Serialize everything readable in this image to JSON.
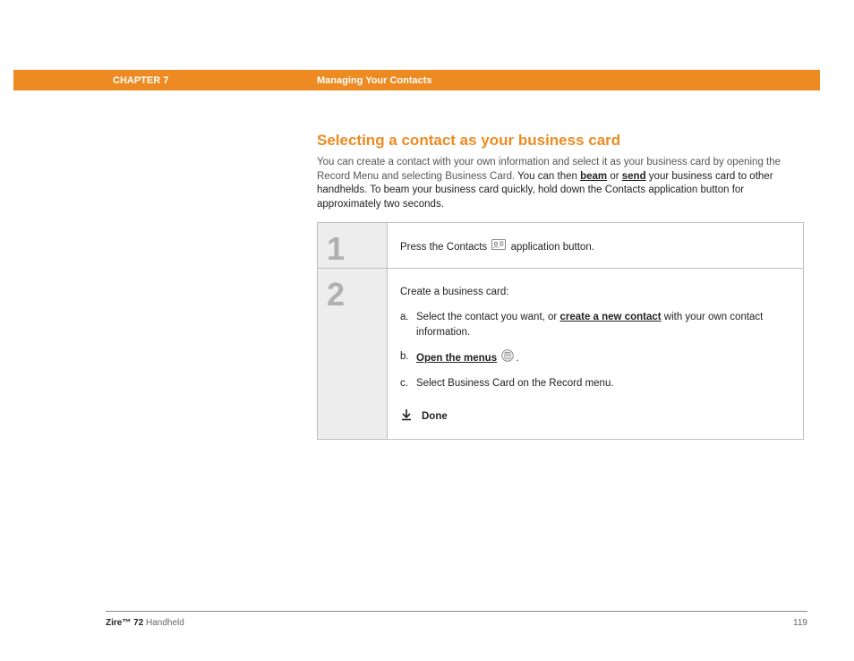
{
  "header": {
    "chapter": "CHAPTER 7",
    "title": "Managing Your Contacts"
  },
  "section": {
    "heading": "Selecting a contact as your business card",
    "intro_gray_part": "You can create a contact with your own information and select it as your business card by opening the Record Menu and selecting Business Card.",
    "intro_dark_prefix": " You can then ",
    "link_beam": "beam",
    "intro_dark_mid": " or ",
    "link_send": "send",
    "intro_dark_suffix": " your business card to other handhelds. To beam your business card quickly, hold down the Contacts application button for approximately two seconds."
  },
  "steps": [
    {
      "num": "1",
      "prefix": "Press the Contacts ",
      "suffix": " application button."
    },
    {
      "num": "2",
      "lead": "Create a business card:",
      "a_prefix": "Select the contact you want, or ",
      "a_link": "create a new contact",
      "a_suffix": " with your own contact information.",
      "b_link": "Open the menus",
      "b_suffix": ".",
      "c": "Select Business Card on the Record menu.",
      "done": "Done"
    }
  ],
  "footer": {
    "product_bold": "Zire™ 72",
    "product_rest": " Handheld",
    "page_num": "119"
  }
}
